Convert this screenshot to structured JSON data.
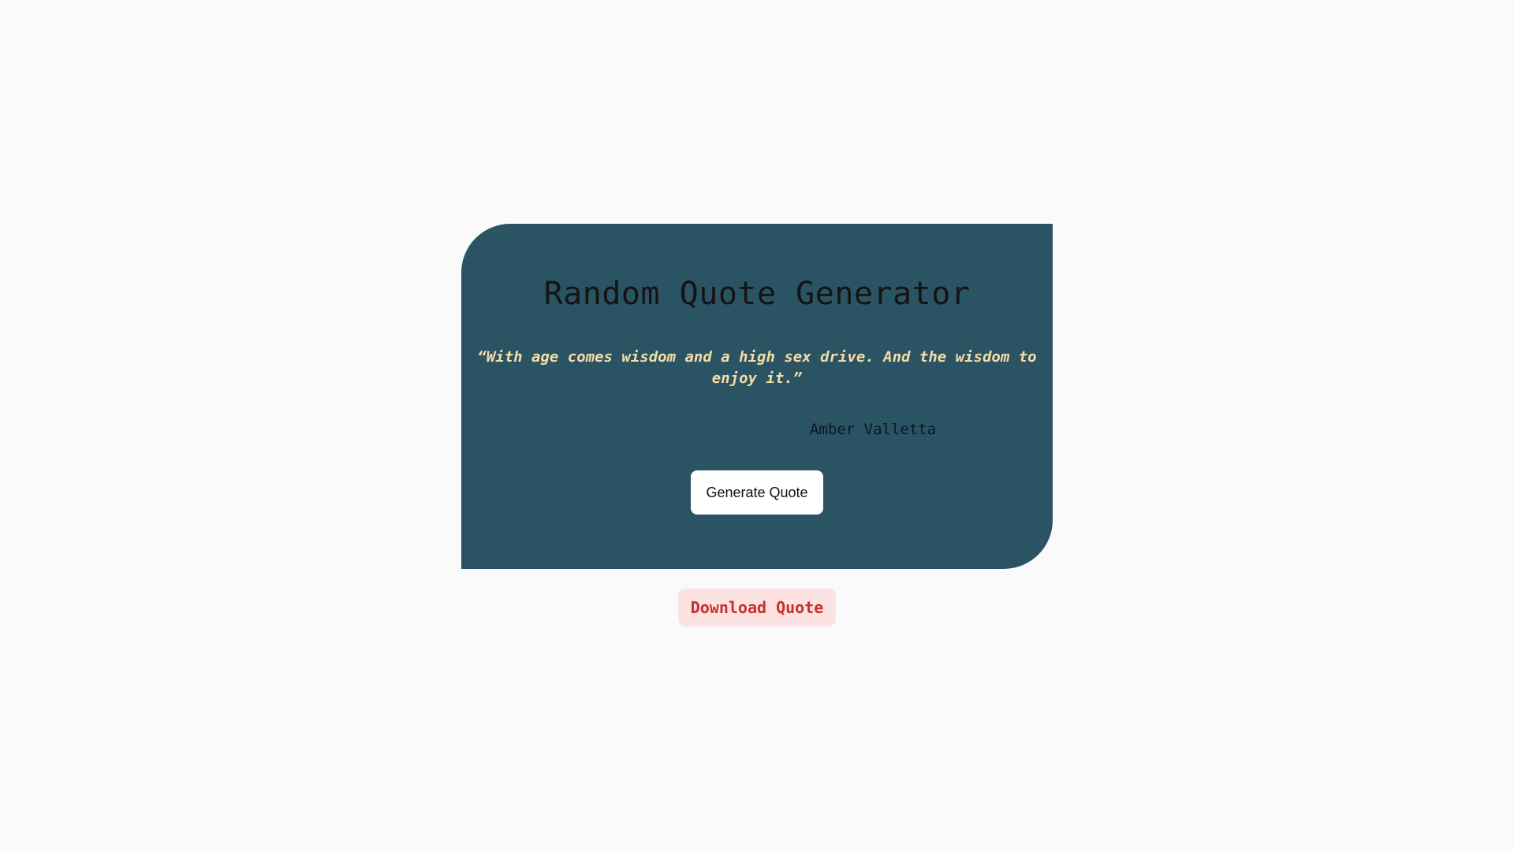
{
  "card": {
    "title": "Random Quote Generator",
    "quote_text": "“With age comes wisdom and a high sex drive. And the wisdom to enjoy it.”",
    "author": "Amber Valletta",
    "generate_label": "Generate Quote"
  },
  "actions": {
    "download_label": "Download Quote"
  },
  "colors": {
    "page_background": "#fafafa",
    "card_background": "#2a5464",
    "quote_text": "#f5dca6",
    "download_background": "#fde2e2",
    "download_text": "#c8302b"
  }
}
